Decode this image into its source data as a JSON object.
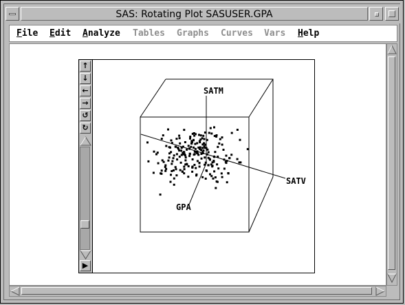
{
  "window": {
    "title": "SAS: Rotating Plot SASUSER.GPA"
  },
  "menu": {
    "items": [
      {
        "label": "File",
        "mnemonic": "F",
        "rest": "ile",
        "enabled": true
      },
      {
        "label": "Edit",
        "mnemonic": "E",
        "rest": "dit",
        "enabled": true
      },
      {
        "label": "Analyze",
        "mnemonic": "A",
        "rest": "nalyze",
        "enabled": true
      },
      {
        "label": "Tables",
        "mnemonic": "",
        "rest": "Tables",
        "enabled": false
      },
      {
        "label": "Graphs",
        "mnemonic": "",
        "rest": "Graphs",
        "enabled": false
      },
      {
        "label": "Curves",
        "mnemonic": "",
        "rest": "Curves",
        "enabled": false
      },
      {
        "label": "Vars",
        "mnemonic": "",
        "rest": "Vars",
        "enabled": false
      },
      {
        "label": "Help",
        "mnemonic": "H",
        "rest": "elp",
        "enabled": true
      }
    ]
  },
  "plot": {
    "axes": {
      "x": "SATV",
      "y": "SATM",
      "z": "GPA"
    },
    "tools": [
      "rotate-up-icon",
      "rotate-down-icon",
      "rotate-left-icon",
      "rotate-right-icon",
      "rotate-ccw-icon",
      "rotate-cw-icon"
    ]
  },
  "colors": {
    "background": "#bcbcbc",
    "plot_bg": "#ffffff",
    "points": "#000000",
    "disabled_text": "#8e8e8e"
  }
}
